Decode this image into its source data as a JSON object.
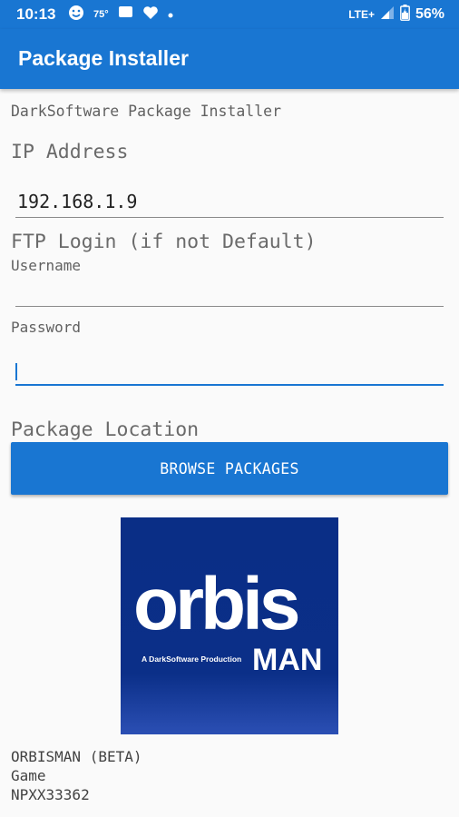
{
  "status_bar": {
    "time": "10:13",
    "temperature": "75°",
    "network": "LTE+",
    "battery": "56%"
  },
  "app_bar": {
    "title": "Package Installer"
  },
  "form": {
    "subtitle": "DarkSoftware Package Installer",
    "ip_label": "IP Address",
    "ip_value": "192.168.1.9",
    "ftp_label": "FTP Login (if not Default)",
    "username_label": "Username",
    "username_value": "",
    "password_label": "Password",
    "password_value": "",
    "package_label": "Package Location",
    "browse_button": "BROWSE PACKAGES"
  },
  "package": {
    "logo_word": "orbis",
    "logo_tagline": "A DarkSoftware Production",
    "logo_suffix": "MAN",
    "name": "ORBISMAN (BETA)",
    "type": "Game",
    "id": "NPXX33362"
  },
  "colors": {
    "primary": "#1976d2",
    "logo_background": "#0a2e86"
  }
}
